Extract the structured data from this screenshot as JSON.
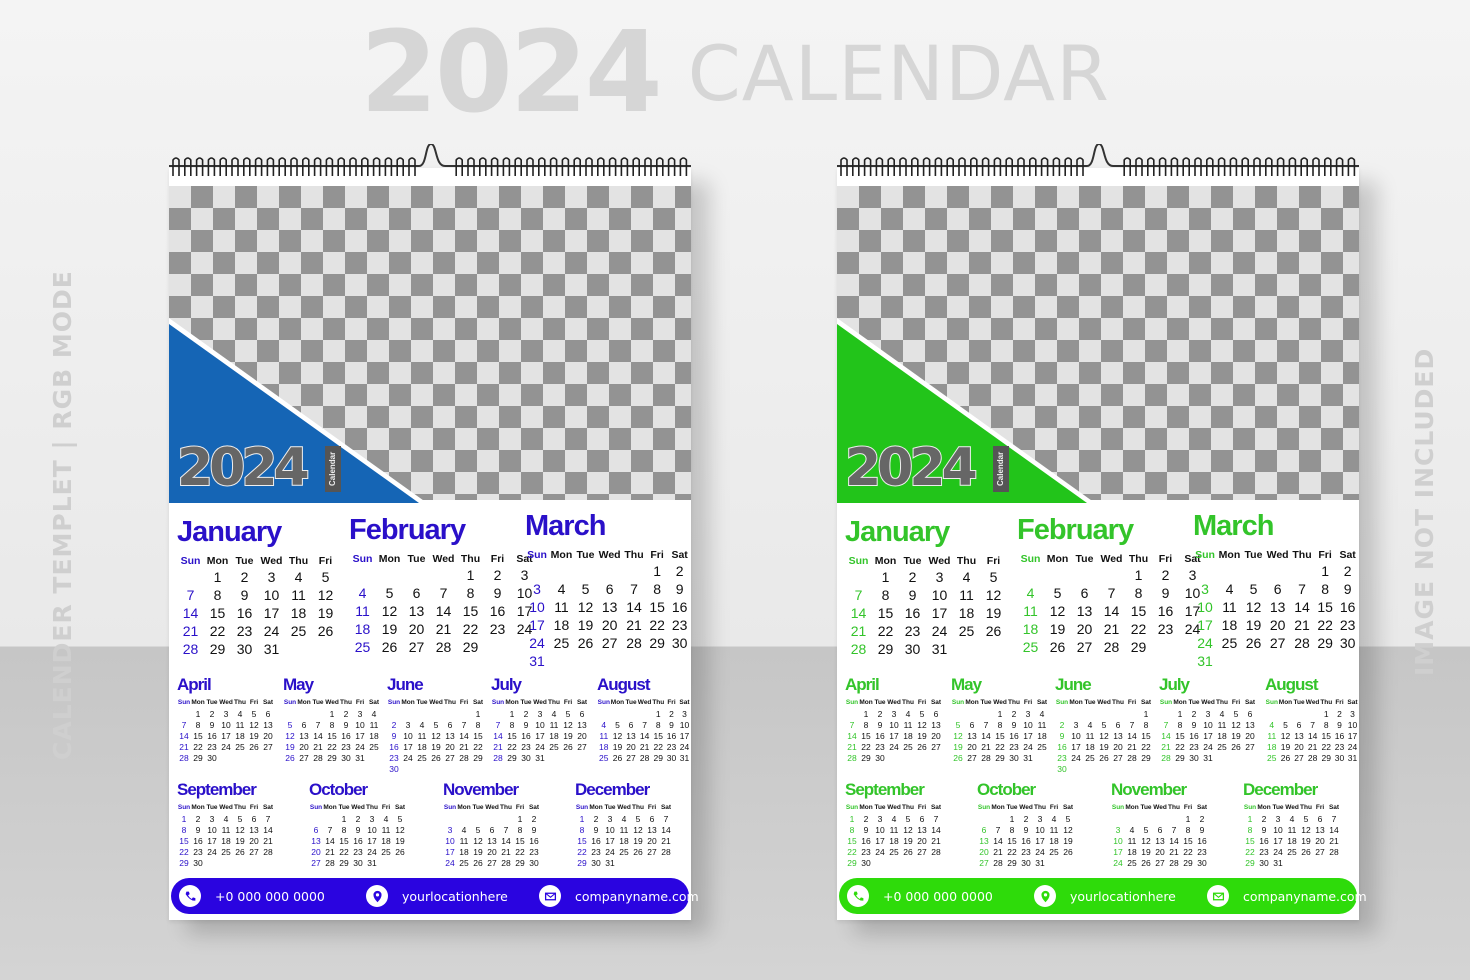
{
  "hero": {
    "year": "2024",
    "word": "CALENDAR"
  },
  "side_left": "CALENDER TEMPLET | RGB MODE",
  "side_right": "IMAGE NOT INCLUDED",
  "weekdays": [
    "Sun",
    "Mon",
    "Tue",
    "Wed",
    "Thu",
    "Fri",
    "Sat"
  ],
  "calendars": [
    {
      "variant": "blue",
      "accent": "#2a10c9",
      "triangle_color": "#1565b5",
      "footer_color": "#2a04e0",
      "badge": {
        "year": "2024",
        "label": "Calendar"
      },
      "footer": {
        "phone": "+0 000 000 0000",
        "location": "yourlocationhere",
        "web": "companyname.com"
      }
    },
    {
      "variant": "green",
      "accent": "#33c42a",
      "triangle_color": "#22c41a",
      "footer_color": "#2edb0a",
      "badge": {
        "year": "2024",
        "label": "Calendar"
      },
      "footer": {
        "phone": "+0 000 000 0000",
        "location": "yourlocationhere",
        "web": "companyname.com"
      }
    }
  ],
  "months": [
    {
      "name": "January",
      "start": 1,
      "days": 31,
      "hide_sat": true
    },
    {
      "name": "February",
      "start": 4,
      "days": 29
    },
    {
      "name": "March",
      "start": 5,
      "days": 31
    },
    {
      "name": "April",
      "start": 1,
      "days": 30
    },
    {
      "name": "May",
      "start": 3,
      "days": 31
    },
    {
      "name": "June",
      "start": 6,
      "days": 30
    },
    {
      "name": "July",
      "start": 1,
      "days": 31
    },
    {
      "name": "August",
      "start": 4,
      "days": 31
    },
    {
      "name": "September",
      "start": 0,
      "days": 30
    },
    {
      "name": "October",
      "start": 2,
      "days": 31
    },
    {
      "name": "November",
      "start": 5,
      "days": 30
    },
    {
      "name": "December",
      "start": 0,
      "days": 31
    }
  ]
}
